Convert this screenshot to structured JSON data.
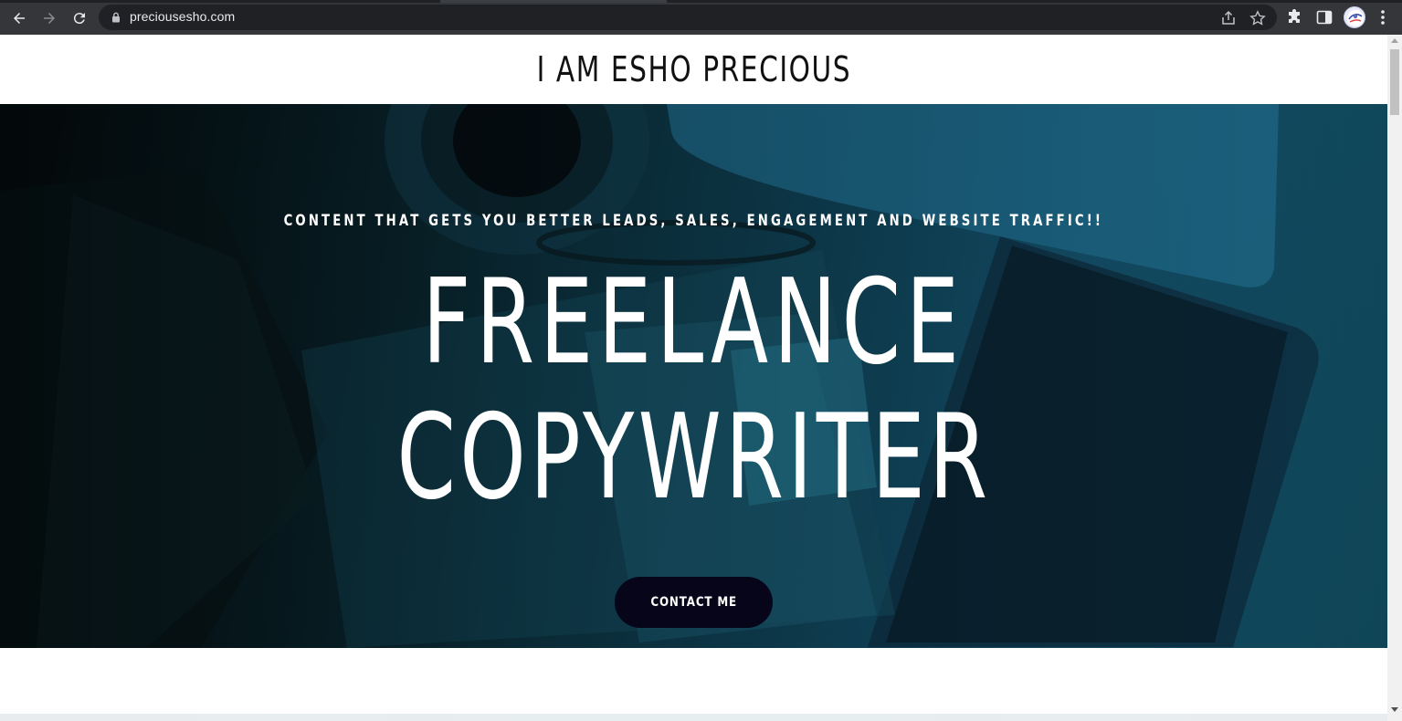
{
  "browser": {
    "url": "preciousesho.com",
    "icons": {
      "back": "back-arrow-icon",
      "forward": "forward-arrow-icon",
      "reload": "reload-icon",
      "lock": "lock-icon",
      "share": "share-icon",
      "bookmark": "star-icon",
      "extensions": "puzzle-icon",
      "side_panel": "side-panel-icon",
      "profile": "avatar",
      "menu": "kebab-menu-icon"
    }
  },
  "page": {
    "site_title": "I AM ESHO PRECIOUS",
    "hero": {
      "tagline": "CONTENT THAT GETS YOU BETTER LEADS, SALES, ENGAGEMENT AND WEBSITE TRAFFIC!!",
      "headline_line1": "FREELANCE",
      "headline_line2": "COPYWRITER",
      "cta_label": "CONTACT ME"
    }
  },
  "colors": {
    "chrome_bg": "#35363a",
    "omnibox_bg": "#202124",
    "cta_bg": "#06051a",
    "hero_tint": "#0f3f52",
    "text_white": "#ffffff"
  }
}
